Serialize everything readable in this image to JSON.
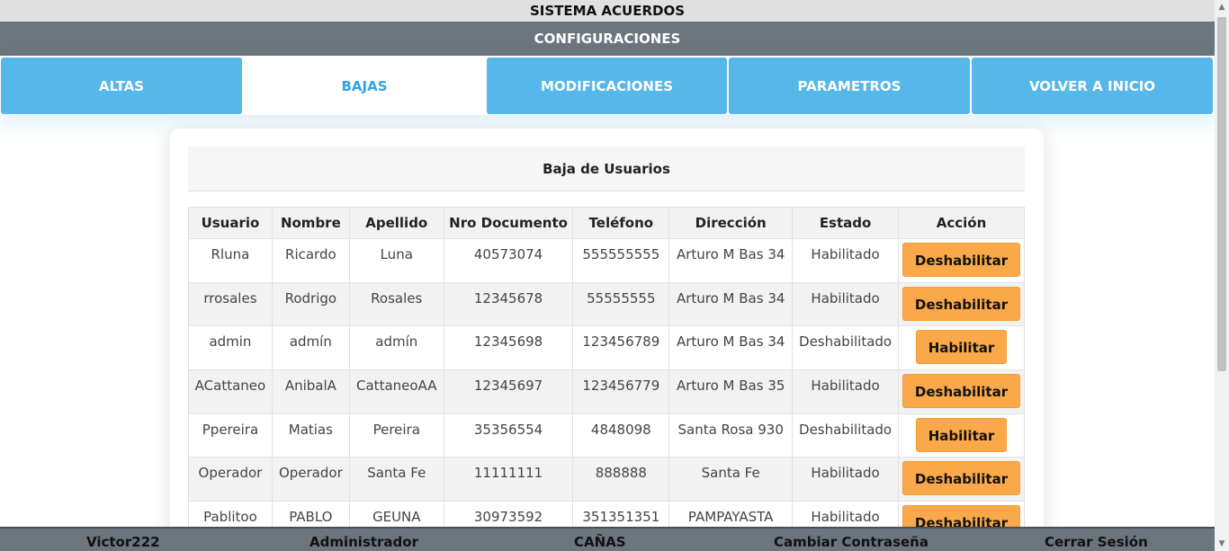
{
  "app_title": "SISTEMA ACUERDOS",
  "section_title": "CONFIGURACIONES",
  "tabs": [
    {
      "label": "ALTAS",
      "active": false
    },
    {
      "label": "BAJAS",
      "active": true
    },
    {
      "label": "MODIFICACIONES",
      "active": false
    },
    {
      "label": "PARAMETROS",
      "active": false
    },
    {
      "label": "VOLVER A INICIO",
      "active": false
    }
  ],
  "card": {
    "title": "Baja de Usuarios",
    "columns": [
      "Usuario",
      "Nombre",
      "Apellido",
      "Nro Documento",
      "Teléfono",
      "Dirección",
      "Estado",
      "Acción"
    ],
    "rows": [
      [
        "Rluna",
        "Ricardo",
        "Luna",
        "40573074",
        "555555555",
        "Arturo M Bas 34",
        "Habilitado",
        "Deshabilitar"
      ],
      [
        "rrosales",
        "Rodrigo",
        "Rosales",
        "12345678",
        "55555555",
        "Arturo M Bas 34",
        "Habilitado",
        "Deshabilitar"
      ],
      [
        "admin",
        "admín",
        "admín",
        "12345698",
        "123456789",
        "Arturo M Bas 34",
        "Deshabilitado",
        "Habilitar"
      ],
      [
        "ACattaneo",
        "AnibalA",
        "CattaneoAA",
        "12345697",
        "123456779",
        "Arturo M Bas 35",
        "Habilitado",
        "Deshabilitar"
      ],
      [
        "Ppereira",
        "Matias",
        "Pereira",
        "35356554",
        "4848098",
        "Santa Rosa 930",
        "Deshabilitado",
        "Habilitar"
      ],
      [
        "Operador",
        "Operador",
        "Santa Fe",
        "11111111",
        "888888",
        "Santa Fe",
        "Habilitado",
        "Deshabilitar"
      ],
      [
        "Pablitoo",
        "PABLO",
        "GEUNA",
        "30973592",
        "351351351",
        "PAMPAYASTA",
        "Habilitado",
        "Deshabilitar"
      ]
    ]
  },
  "footer": {
    "user": "Victor222",
    "role": "Administrador",
    "location": "CAÑAS",
    "change_password": "Cambiar Contraseña",
    "logout": "Cerrar Sesión"
  },
  "colors": {
    "tab_blue": "#56b7eb",
    "active_tab_text": "#2fa4e7",
    "header_gray": "#6c757d",
    "action_orange": "#f9a84a"
  }
}
